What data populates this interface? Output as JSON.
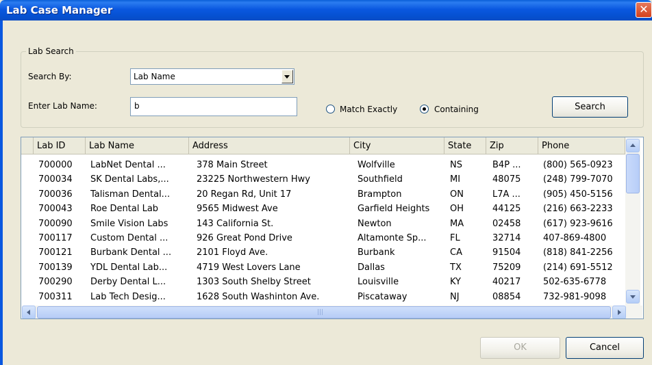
{
  "window": {
    "title": "Lab Case Manager",
    "close_glyph": "✕"
  },
  "search": {
    "group_label": "Lab Search",
    "search_by_label": "Search By:",
    "search_by_value": "Lab Name",
    "enter_label": "Enter Lab Name:",
    "query_value": "b",
    "match_exactly_label": "Match Exactly",
    "containing_label": "Containing",
    "selected_mode": "Containing",
    "search_button": "Search"
  },
  "table": {
    "columns": [
      "Lab ID",
      "Lab Name",
      "Address",
      "City",
      "State",
      "Zip",
      "Phone"
    ],
    "rows": [
      [
        "700000",
        "LabNet Dental ...",
        "378 Main Street",
        "Wolfville",
        "NS",
        "B4P ...",
        "(800) 565-0923"
      ],
      [
        "700034",
        "SK Dental Labs,...",
        "23225 Northwestern Hwy",
        "Southfield",
        "MI",
        "48075",
        "(248) 799-7070"
      ],
      [
        "700036",
        "Talisman Dental...",
        "20 Regan Rd, Unit 17",
        "Brampton",
        "ON",
        "L7A ...",
        "(905) 450-5156"
      ],
      [
        "700043",
        "Roe Dental Lab",
        "9565 Midwest Ave",
        "Garfield Heights",
        "OH",
        "44125",
        "(216) 663-2233"
      ],
      [
        "700090",
        "Smile Vision Labs",
        "143 California St.",
        "Newton",
        "MA",
        "02458",
        "(617) 923-9616"
      ],
      [
        "700117",
        "Custom Dental ...",
        "926 Great Pond Drive",
        "Altamonte Sp...",
        "FL",
        "32714",
        "407-869-4800"
      ],
      [
        "700121",
        "Burbank Dental ...",
        "2101 Floyd Ave.",
        "Burbank",
        "CA",
        "91504",
        "(818) 841-2256"
      ],
      [
        "700139",
        "YDL Dental Lab...",
        "4719 West Lovers Lane",
        "Dallas",
        "TX",
        "75209",
        "(214) 691-5512"
      ],
      [
        "700290",
        "Derby Dental L...",
        "1303 South Shelby Street",
        "Louisville",
        "KY",
        "40217",
        "502-635-6778"
      ],
      [
        "700311",
        "Lab Tech Desig...",
        "1628 South Washinton Ave.",
        "Piscataway",
        "NJ",
        "08854",
        "732-981-9098"
      ]
    ]
  },
  "footer": {
    "ok_label": "OK",
    "cancel_label": "Cancel"
  },
  "colors": {
    "titlebar": "#0a58e0",
    "dialog_bg": "#ece9d8",
    "close_button": "#d2401c"
  }
}
